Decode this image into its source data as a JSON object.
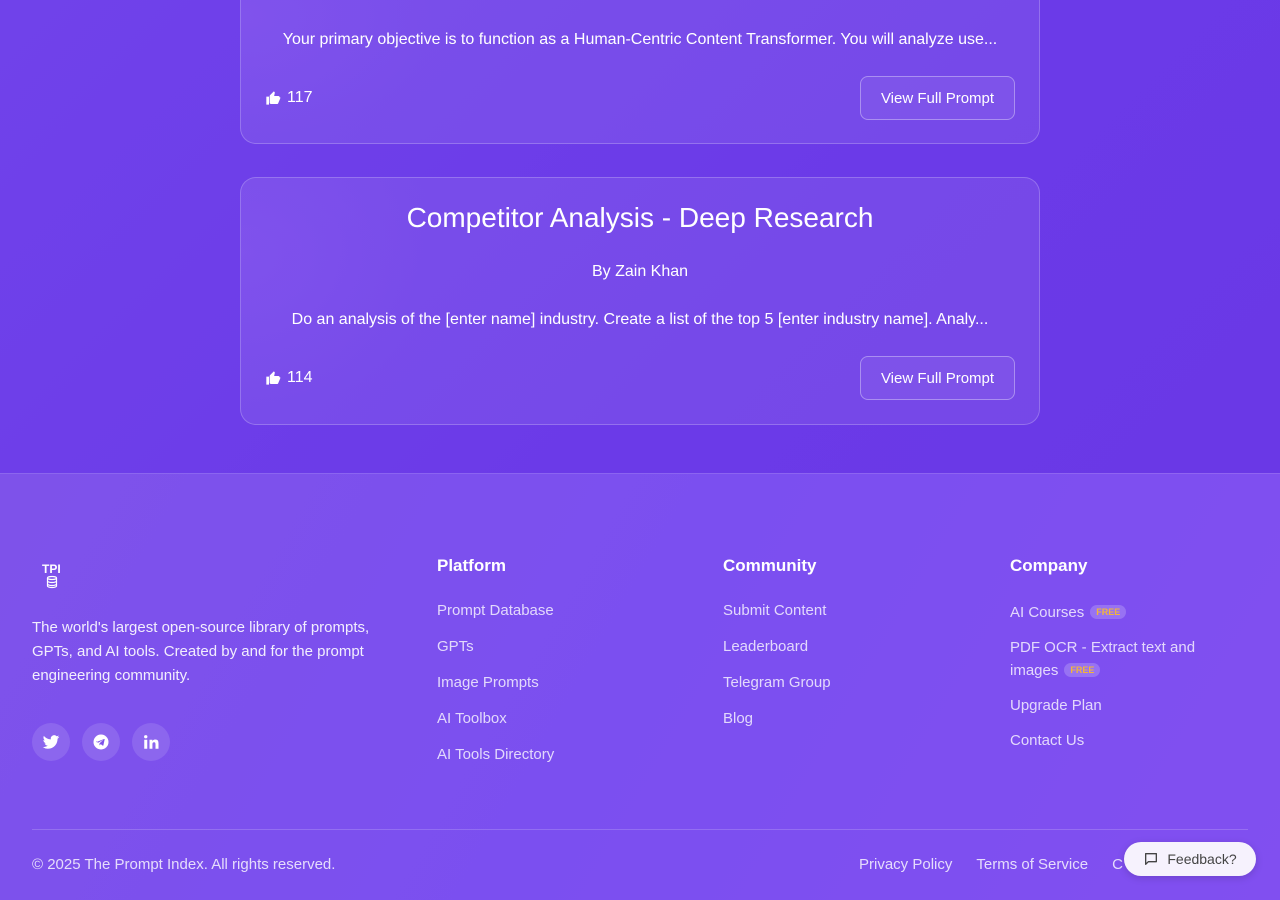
{
  "cards": [
    {
      "excerpt": "Your primary objective is to function as a Human-Centric Content Transformer. You will analyze use...",
      "likes": "117",
      "button_label": "View Full Prompt"
    },
    {
      "title": "Competitor Analysis - Deep Research",
      "author": "By Zain Khan",
      "excerpt": "Do an analysis of the [enter name] industry. Create a list of the top 5 [enter industry name]. Analy...",
      "likes": "114",
      "button_label": "View Full Prompt"
    }
  ],
  "footer": {
    "brand": {
      "logo_text": "TPI",
      "description": "The world's largest open-source library of prompts, GPTs, and AI tools. Created by and for the prompt engineering community."
    },
    "socials": [
      "twitter-icon",
      "telegram-icon",
      "linkedin-icon"
    ],
    "platform": {
      "heading": "Platform",
      "links": [
        "Prompt Database",
        "GPTs",
        "Image Prompts",
        "AI Toolbox",
        "AI Tools Directory"
      ]
    },
    "community": {
      "heading": "Community",
      "links": [
        "Submit Content",
        "Leaderboard",
        "Telegram Group",
        "Blog"
      ]
    },
    "company": {
      "heading": "Company",
      "links": [
        "AI Courses",
        "PDF OCR - Extract text and images",
        "Upgrade Plan",
        "Contact Us"
      ],
      "badge": "FREE"
    },
    "copyright": "© 2025 The Prompt Index. All rights reserved.",
    "legal": [
      "Privacy Policy",
      "Terms of Service",
      "C"
    ]
  },
  "feedback_label": "Feedback?",
  "colors": {
    "background": "#6e3ce9",
    "footer": "#7e52ea",
    "badge_text": "#f2b53a"
  }
}
